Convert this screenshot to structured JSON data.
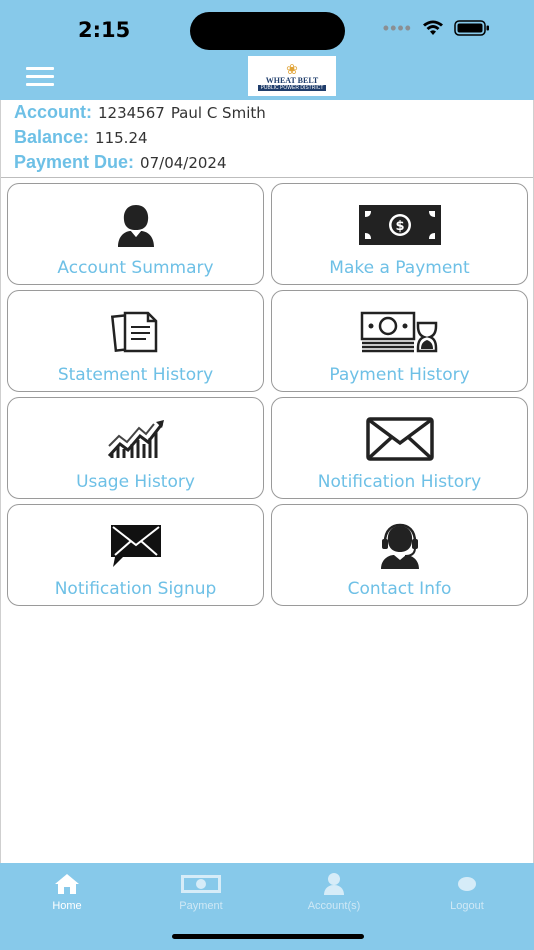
{
  "status_bar": {
    "time": "2:15"
  },
  "header": {
    "logo_text": "WHEAT BELT",
    "logo_subtext": "PUBLIC POWER DISTRICT"
  },
  "account": {
    "account_label": "Account:",
    "account_number": "1234567",
    "account_name": "Paul C Smith",
    "balance_label": "Balance:",
    "balance_value": "115.24",
    "due_label": "Payment Due:",
    "due_value": "07/04/2024"
  },
  "tiles": [
    {
      "label": "Account Summary",
      "icon": "user-icon"
    },
    {
      "label": "Make a Payment",
      "icon": "money-bill-icon"
    },
    {
      "label": "Statement History",
      "icon": "documents-icon"
    },
    {
      "label": "Payment History",
      "icon": "money-hourglass-icon"
    },
    {
      "label": "Usage History",
      "icon": "trend-chart-icon"
    },
    {
      "label": "Notification History",
      "icon": "envelope-icon"
    },
    {
      "label": "Notification Signup",
      "icon": "message-envelope-icon"
    },
    {
      "label": "Contact Info",
      "icon": "headset-agent-icon"
    }
  ],
  "tab_bar": {
    "tabs": [
      {
        "label": "Home",
        "icon": "home-icon",
        "active": true
      },
      {
        "label": "Payment",
        "icon": "money-icon",
        "active": false
      },
      {
        "label": "Account(s)",
        "icon": "user-icon",
        "active": false
      },
      {
        "label": "Logout",
        "icon": "logout-icon",
        "active": false
      }
    ]
  },
  "colors": {
    "header_bg": "#87c9ea",
    "accent_text": "#6ec0e6",
    "tile_border": "#9a9a9a"
  }
}
